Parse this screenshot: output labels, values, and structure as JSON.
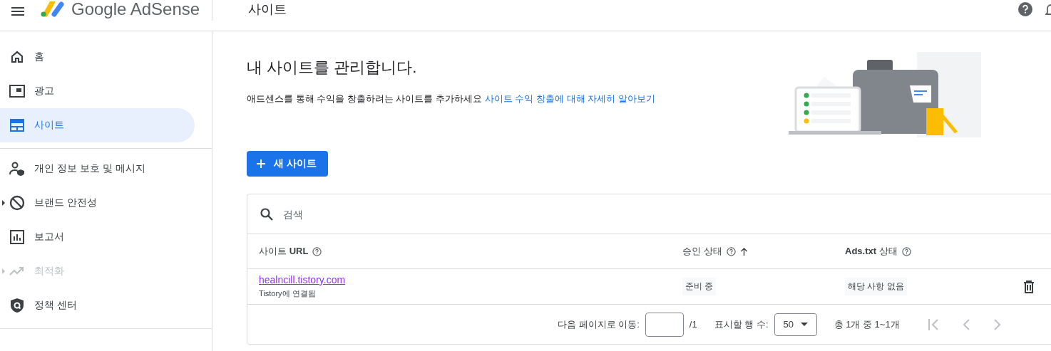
{
  "header": {
    "product": "Google AdSense",
    "page_title": "사이트"
  },
  "sidebar": {
    "groups": [
      [
        {
          "label": "홈",
          "selected": false,
          "disabled": false,
          "expandable": false
        },
        {
          "label": "광고",
          "selected": false,
          "disabled": false,
          "expandable": false
        },
        {
          "label": "사이트",
          "selected": true,
          "disabled": false,
          "expandable": false
        }
      ],
      [
        {
          "label": "개인 정보 보호 및 메시지",
          "selected": false,
          "disabled": false,
          "expandable": false
        },
        {
          "label": "브랜드 안전성",
          "selected": false,
          "disabled": false,
          "expandable": true
        },
        {
          "label": "보고서",
          "selected": false,
          "disabled": false,
          "expandable": false
        },
        {
          "label": "최적화",
          "selected": false,
          "disabled": true,
          "expandable": true
        },
        {
          "label": "정책 센터",
          "selected": false,
          "disabled": false,
          "expandable": false
        }
      ]
    ]
  },
  "intro": {
    "title": "내 사이트를 관리합니다.",
    "description": "애드센스를 통해 수익을 창출하려는 사이트를 추가하세요",
    "link": "사이트 수익 창출에 대해 자세히 알아보기"
  },
  "new_site_button": "새 사이트",
  "table": {
    "search_placeholder": "검색",
    "columns": [
      {
        "label": "사이트 **URL**",
        "sorted": false
      },
      {
        "label": "승인 상태",
        "sorted": true
      },
      {
        "label": "**Ads.txt** 상태",
        "sorted": false
      }
    ],
    "rows": [
      {
        "url": "healncill.tistory.com",
        "connection": "Tistory에 연결됨",
        "approval": "준비 중",
        "ads_txt": "해당 사항 없음"
      }
    ],
    "pagination": {
      "goto_label": "다음 페이지로 이동:",
      "page_total": "/1",
      "rows_label": "표시할 행 수:",
      "rows_per_page": "50",
      "range": "총 1개 중 1~1개"
    }
  }
}
